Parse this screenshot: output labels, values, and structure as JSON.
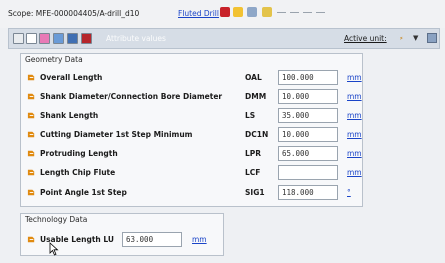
{
  "scope": {
    "label": "Scope: MFE-000004405/A-drill_d10",
    "link": "Fluted Drill"
  },
  "toolbar": {
    "attribute_values": "Attribute values",
    "active_unit_label": "Active unit:",
    "active_unit_value": "⸗"
  },
  "geometry": {
    "title": "Geometry Data",
    "rows": [
      {
        "label": "Overall Length",
        "abbr": "OAL",
        "value": "100.000",
        "unit": "mm"
      },
      {
        "label": "Shank Diameter/Connection Bore Diameter",
        "abbr": "DMM",
        "value": "10.000",
        "unit": "mm"
      },
      {
        "label": "Shank Length",
        "abbr": "LS",
        "value": "35.000",
        "unit": "mm"
      },
      {
        "label": "Cutting Diameter 1st Step Minimum",
        "abbr": "DC1N",
        "value": "10.000",
        "unit": "mm"
      },
      {
        "label": "Protruding Length",
        "abbr": "LPR",
        "value": "65.000",
        "unit": "mm"
      },
      {
        "label": "Length Chip Flute",
        "abbr": "LCF",
        "value": "",
        "unit": "mm"
      },
      {
        "label": "Point Angle 1st Step",
        "abbr": "SIG1",
        "value": "118.000",
        "unit": "°"
      }
    ]
  },
  "technology": {
    "title": "Technology Data",
    "rows": [
      {
        "label": "Usable Length LU",
        "value": "63.000",
        "unit": "mm"
      }
    ]
  },
  "icons": {
    "row_icon": "folder-arrow-icon",
    "cursor": "mouse-pointer-icon"
  },
  "colors": {
    "link": "#1a44c8",
    "toolbar_bg": "#d6dde6",
    "row_icon": "#e08a10"
  }
}
